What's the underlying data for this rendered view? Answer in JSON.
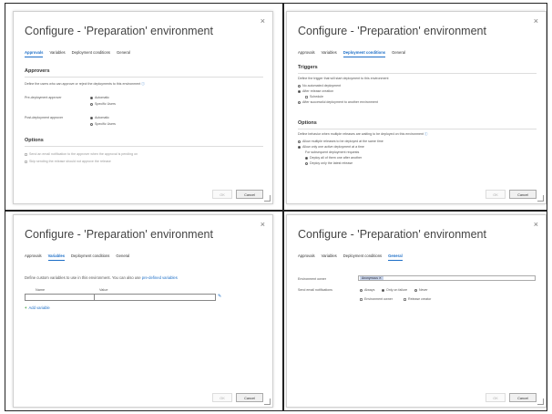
{
  "common": {
    "dialog_title": "Configure - 'Preparation' environment",
    "close_glyph": "×",
    "ok_label": "OK",
    "cancel_label": "Cancel",
    "tabs": [
      "Approvals",
      "Variables",
      "Deployment conditions",
      "General"
    ]
  },
  "approvals": {
    "section": "Approvers",
    "intro": "Define the users who can approve or reject the deployments to this environment",
    "pre_label": "Pre-deployment approver",
    "post_label": "Post-deployment approver",
    "opt_automatic": "Automatic",
    "opt_specific": "Specific Users",
    "options_section": "Options",
    "opt1": "Send an email notification to the approver when the approval is pending on",
    "opt2": "Skip sending the release should not approve the release"
  },
  "conditions": {
    "triggers_section": "Triggers",
    "triggers_intro": "Define the trigger that will start deployment to this environment",
    "t1": "No automated deployment",
    "t2": "After release creation",
    "t2_sub": "Schedule",
    "t3": "After successful deployment to another environment",
    "options_section": "Options",
    "options_intro": "Define behavior when multiple releases are waiting to be deployed on this environment",
    "o1": "Allow multiple releases to be deployed at the same time",
    "o2": "Allow only one active deployment at a time",
    "o2_sub": "For subsequent deployment requests",
    "o3": "Deploy all of them one after another",
    "o4": "Deploy only the latest release"
  },
  "variables": {
    "intro": "Define custom variables to use in this environment. You can also use",
    "intro_link": "pre-defined variables",
    "col_name": "Name",
    "col_value": "Value",
    "add_label": "Add variable",
    "plus_glyph": "+"
  },
  "general": {
    "env_owner_label": "Environment owner",
    "env_owner_value": "Anonymous ✕",
    "email_label": "Send email notifications",
    "r_always": "Always",
    "r_only_failure": "Only on failure",
    "r_never": "Never",
    "c_env_owner": "Environment owner",
    "c_release_creator": "Release creator"
  }
}
